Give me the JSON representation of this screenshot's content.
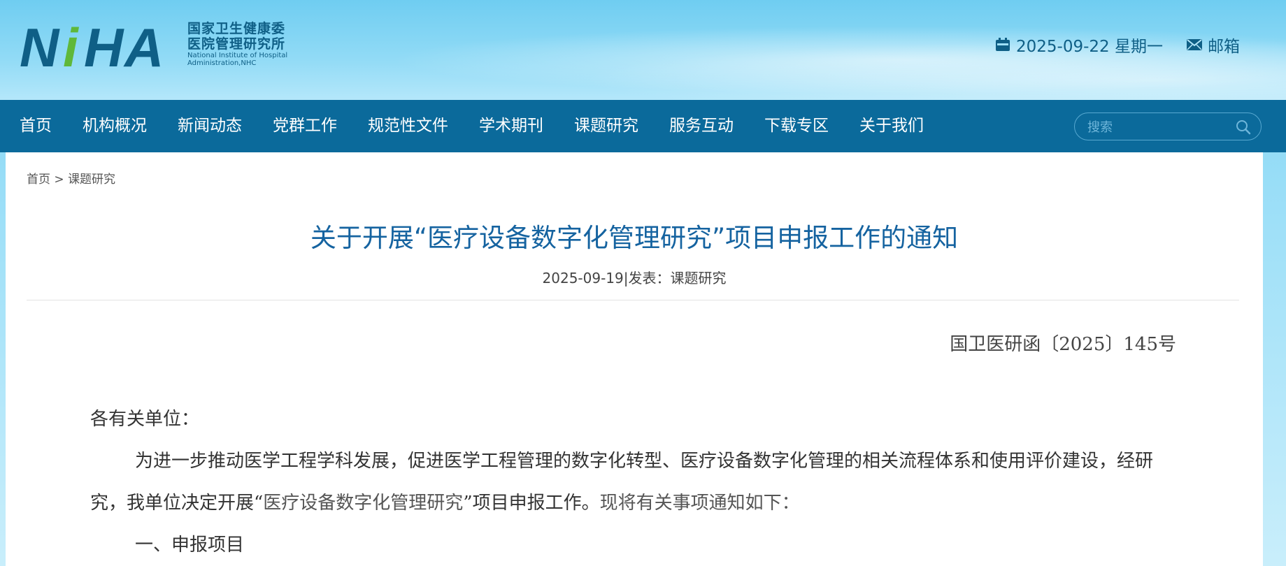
{
  "header": {
    "logo_mark": "NiHA",
    "logo_cn_line1": "国家卫生健康委",
    "logo_cn_line2": "医院管理研究所",
    "logo_en_line1": "National Institute of Hospital",
    "logo_en_line2": "Administration,NHC",
    "date_text": "2025-09-22 星期一",
    "mail_label": "邮箱"
  },
  "nav": {
    "items": [
      "首页",
      "机构概况",
      "新闻动态",
      "党群工作",
      "规范性文件",
      "学术期刊",
      "课题研究",
      "服务互动",
      "下载专区",
      "关于我们"
    ],
    "search_placeholder": "搜索"
  },
  "breadcrumb": {
    "home": "首页",
    "sep": ">",
    "current": "课题研究"
  },
  "article": {
    "title": "关于开展“医疗设备数字化管理研究”项目申报工作的通知",
    "meta": "2025-09-19|发表：课题研究",
    "doc_number": "国卫医研函〔2025〕145号",
    "salutation": "各有关单位：",
    "para1_part1": "为进一步推动医学工程学科发展，促进医学工程管理的数字化转型、医疗设备数字化管理的相关流程体系和使用评价建设，经研究，我单位决定开展“",
    "para1_highlight": "医疗设备数字化管理研究",
    "para1_part2": "”项目申报工作。",
    "para1_part3": "现将有关事项通知如下：",
    "section1": "一、申报项目"
  },
  "colors": {
    "nav_bg": "#0b6a9b",
    "title_blue": "#1563a0",
    "logo_blue": "#0f5f86",
    "logo_green": "#5fb83a"
  }
}
